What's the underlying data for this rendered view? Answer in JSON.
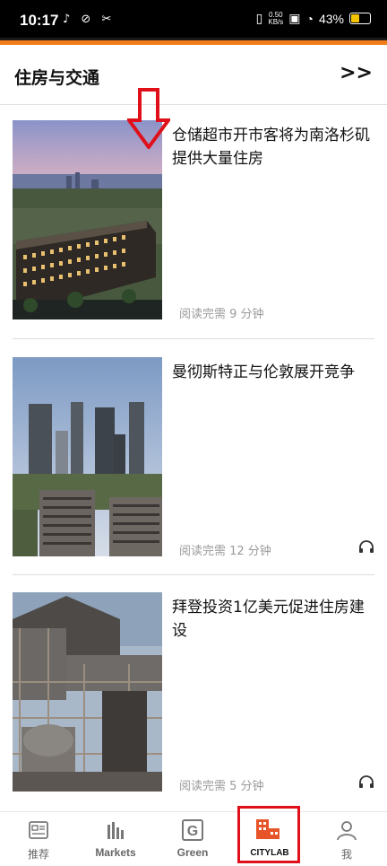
{
  "status": {
    "time": "10:17",
    "speed_value": "0.50",
    "speed_unit": "KB/s",
    "battery": "43%"
  },
  "section": {
    "title": "住房与交通",
    "more": ">>"
  },
  "articles": [
    {
      "title": "仓储超市开市客将为南洛杉矶提供大量住房",
      "read_time": "阅读完需 9 分钟",
      "has_audio": false
    },
    {
      "title": "曼彻斯特正与伦敦展开竞争",
      "read_time": "阅读完需 12 分钟",
      "has_audio": true
    },
    {
      "title": "拜登投资1亿美元促进住房建设",
      "read_time": "阅读完需 5 分钟",
      "has_audio": true
    }
  ],
  "tabs": [
    {
      "label": "推荐",
      "icon": "news-icon"
    },
    {
      "label": "Markets",
      "icon": "chart-icon"
    },
    {
      "label": "Green",
      "icon": "green-icon"
    },
    {
      "label": "CITYLAB",
      "icon": "citylab-icon"
    },
    {
      "label": "我",
      "icon": "profile-icon"
    }
  ],
  "colors": {
    "accent": "#f07d1a",
    "highlight": "#e0101a",
    "citylab": "#e8542a"
  }
}
